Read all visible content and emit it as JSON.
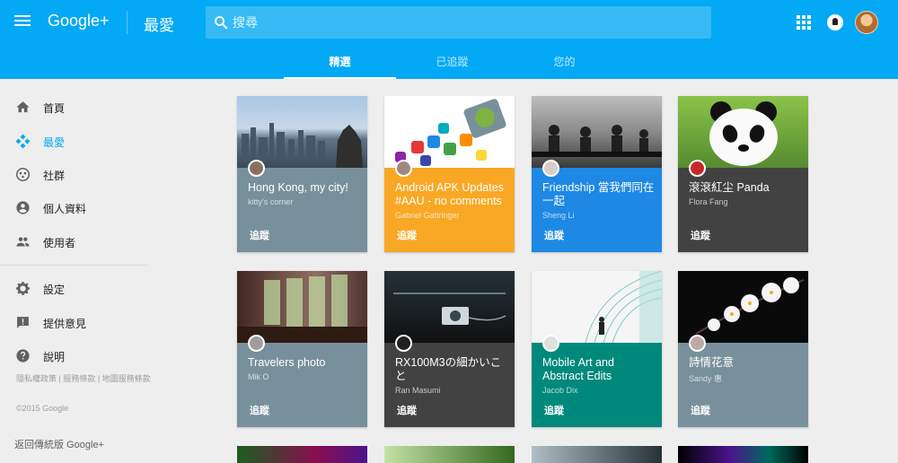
{
  "header": {
    "logo": "Google+",
    "page_title": "最愛",
    "search_placeholder": "搜尋"
  },
  "tabs": [
    {
      "label": "精選",
      "active": true
    },
    {
      "label": "已追蹤",
      "active": false
    },
    {
      "label": "您的",
      "active": false
    }
  ],
  "sidebar": {
    "items": [
      {
        "label": "首頁",
        "icon": "home-icon"
      },
      {
        "label": "最愛",
        "icon": "collections-icon",
        "active": true
      },
      {
        "label": "社群",
        "icon": "communities-icon"
      },
      {
        "label": "個人資料",
        "icon": "profile-icon"
      },
      {
        "label": "使用者",
        "icon": "people-icon"
      },
      {
        "label": "設定",
        "icon": "gear-icon"
      },
      {
        "label": "提供意見",
        "icon": "feedback-icon"
      },
      {
        "label": "說明",
        "icon": "help-icon"
      }
    ],
    "footer_links": "隱私權政策 | 服務條款 | 地圖服務條款",
    "copyright": "©2015 Google",
    "classic_link": "返回傳統版 Google+"
  },
  "cards": [
    {
      "title": "Hong Kong, my city!",
      "owner": "kitty's corner",
      "follow": "追蹤",
      "color": "#78909c"
    },
    {
      "title": "Android APK Updates #AAU - no comments",
      "owner": "Gabriel Gattringer",
      "follow": "追蹤",
      "color": "#f9a825"
    },
    {
      "title": "Friendship 當我們同在一起",
      "owner": "Sheng Li",
      "follow": "追蹤",
      "color": "#1e88e5"
    },
    {
      "title": "滾滾紅尘 Panda",
      "owner": "Flora Fang",
      "follow": "追蹤",
      "color": "#424242"
    },
    {
      "title": "Travelers photo",
      "owner": "Mik O",
      "follow": "追蹤",
      "color": "#78909c"
    },
    {
      "title": "RX100M3の細かいこと",
      "owner": "Ran Masumi",
      "follow": "追蹤",
      "color": "#424242"
    },
    {
      "title": "Mobile Art and Abstract Edits",
      "owner": "Jacob Dix",
      "follow": "追蹤",
      "color": "#00897b"
    },
    {
      "title": "詩情花意",
      "owner": "Sandy 惠",
      "follow": "追蹤",
      "color": "#78909c"
    }
  ]
}
